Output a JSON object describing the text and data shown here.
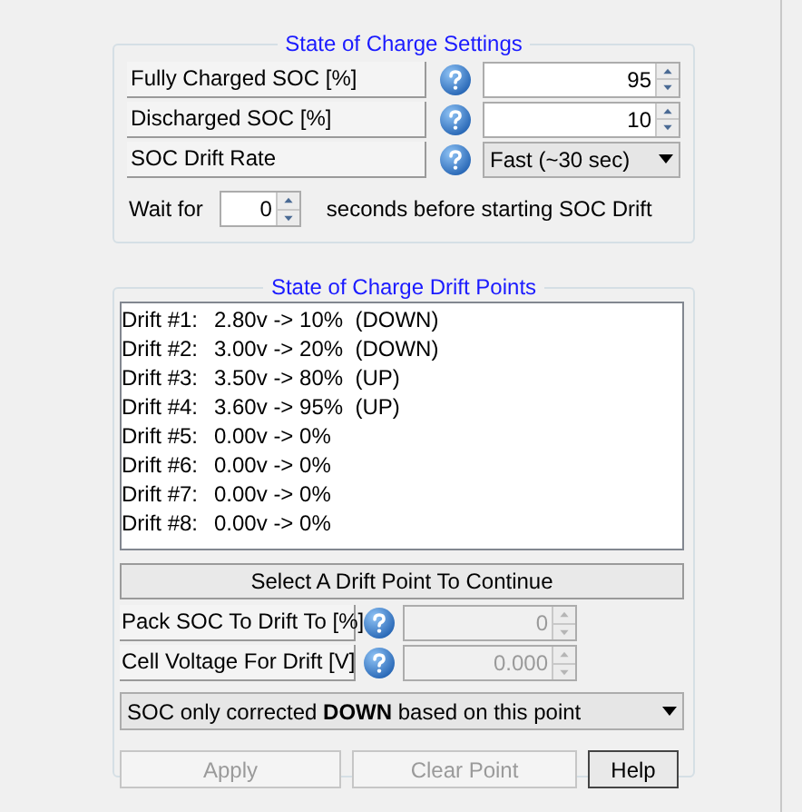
{
  "settings": {
    "title": "State of Charge Settings",
    "rows": [
      {
        "kind": "spinner",
        "label": "Fully Charged SOC [%]",
        "value": "95"
      },
      {
        "kind": "spinner",
        "label": "Discharged SOC [%]",
        "value": "10"
      },
      {
        "kind": "dropdown",
        "label": "SOC Drift Rate",
        "value": "Fast (~30 sec)"
      }
    ],
    "wait": {
      "prefix": "Wait for",
      "value": "0",
      "suffix": "seconds before starting SOC Drift"
    }
  },
  "drift": {
    "title": "State of Charge Drift Points",
    "points": [
      {
        "label": "Drift #1:",
        "value": "2.80v -> 10%  (DOWN)",
        "selected": false
      },
      {
        "label": "Drift #2:",
        "value": "3.00v -> 20%  (DOWN)",
        "selected": false
      },
      {
        "label": "Drift #3:",
        "value": "3.50v -> 80%  (UP)",
        "selected": false
      },
      {
        "label": "Drift #4:",
        "value": "3.60v -> 95%  (UP)",
        "selected": false
      },
      {
        "label": "Drift #5:",
        "value": "0.00v -> 0%",
        "selected": false
      },
      {
        "label": "Drift #6:",
        "value": "0.00v -> 0%",
        "selected": false
      },
      {
        "label": "Drift #7:",
        "value": "0.00v -> 0%",
        "selected": false
      },
      {
        "label": "Drift #8:",
        "value": "0.00v -> 0%",
        "selected": false
      }
    ],
    "select_button": "Select A Drift Point To Continue",
    "fields": [
      {
        "label": "Pack SOC To Drift To [%]",
        "value": "0",
        "disabled": true
      },
      {
        "label": "Cell Voltage For Drift [V]",
        "value": "0.000",
        "disabled": true
      }
    ],
    "direction": "SOC only corrected **DOWN** based on this point",
    "buttons": [
      {
        "label": "Apply",
        "disabled": true
      },
      {
        "label": "Clear Point",
        "disabled": true
      },
      {
        "label": "Help",
        "disabled": false
      }
    ]
  }
}
